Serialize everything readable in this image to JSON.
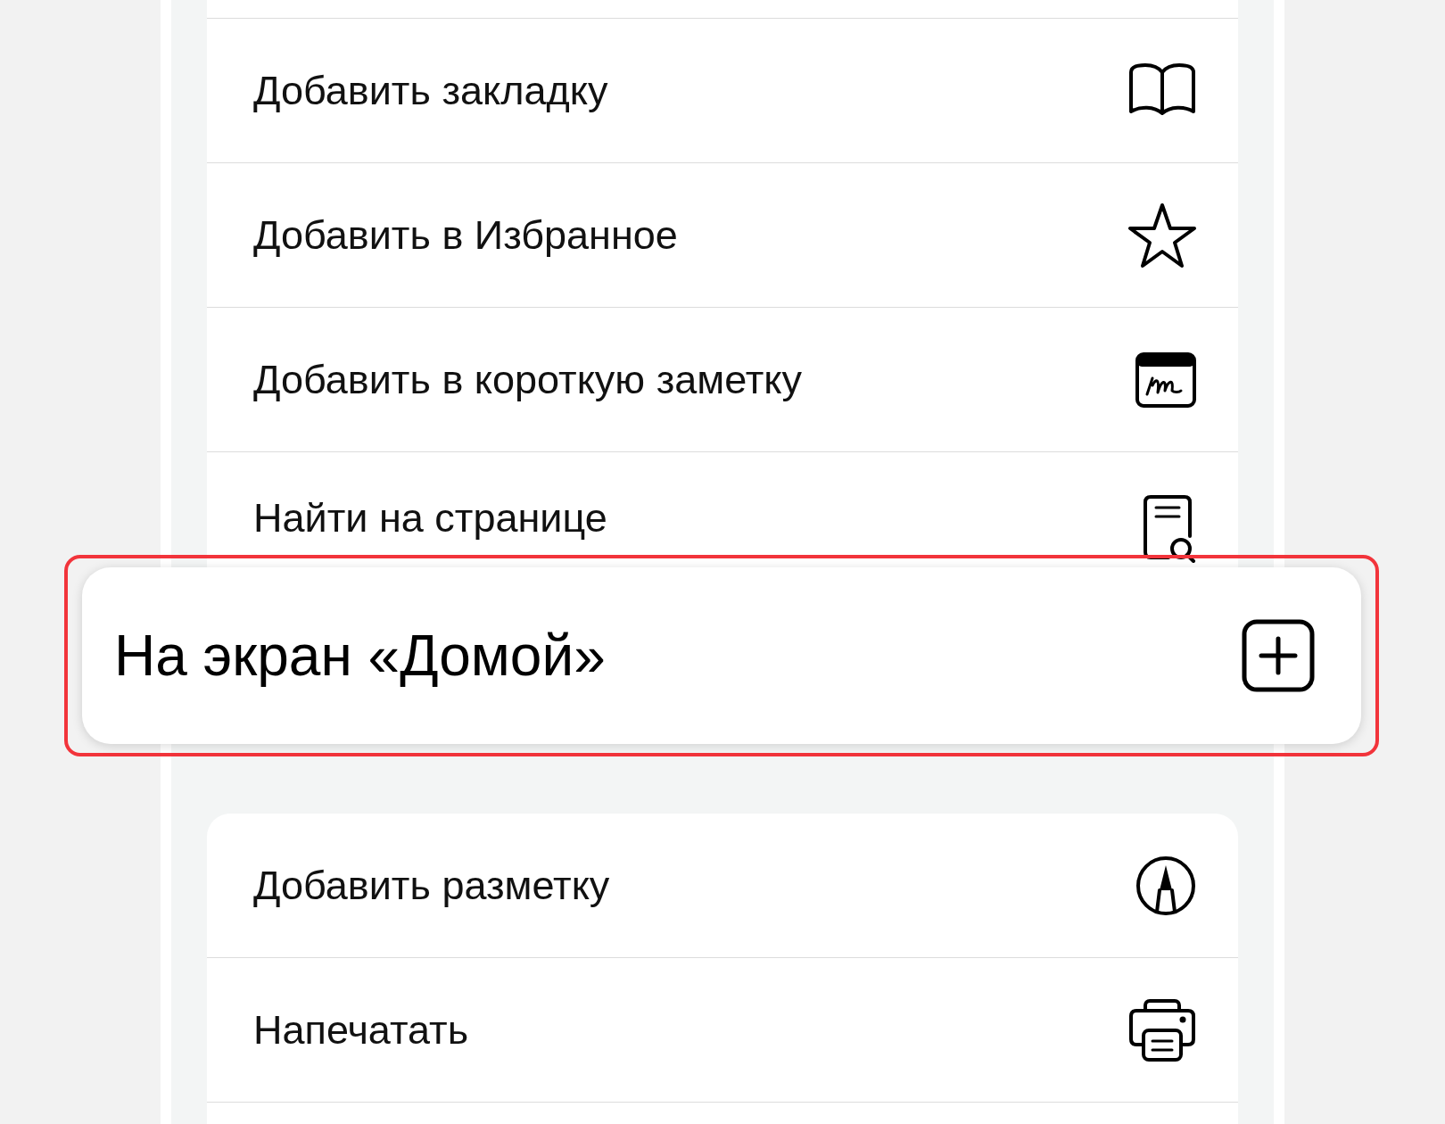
{
  "menu_groups": [
    {
      "items": [
        {
          "label": "Добавить закладку"
        },
        {
          "label": "Добавить в Избранное"
        },
        {
          "label": "Добавить в короткую заметку"
        },
        {
          "label": "Найти на странице"
        }
      ]
    },
    {
      "items": [
        {
          "label": "Добавить разметку"
        },
        {
          "label": "Напечатать"
        }
      ]
    }
  ],
  "lifted_item": {
    "label": "На экран «Домой»"
  }
}
